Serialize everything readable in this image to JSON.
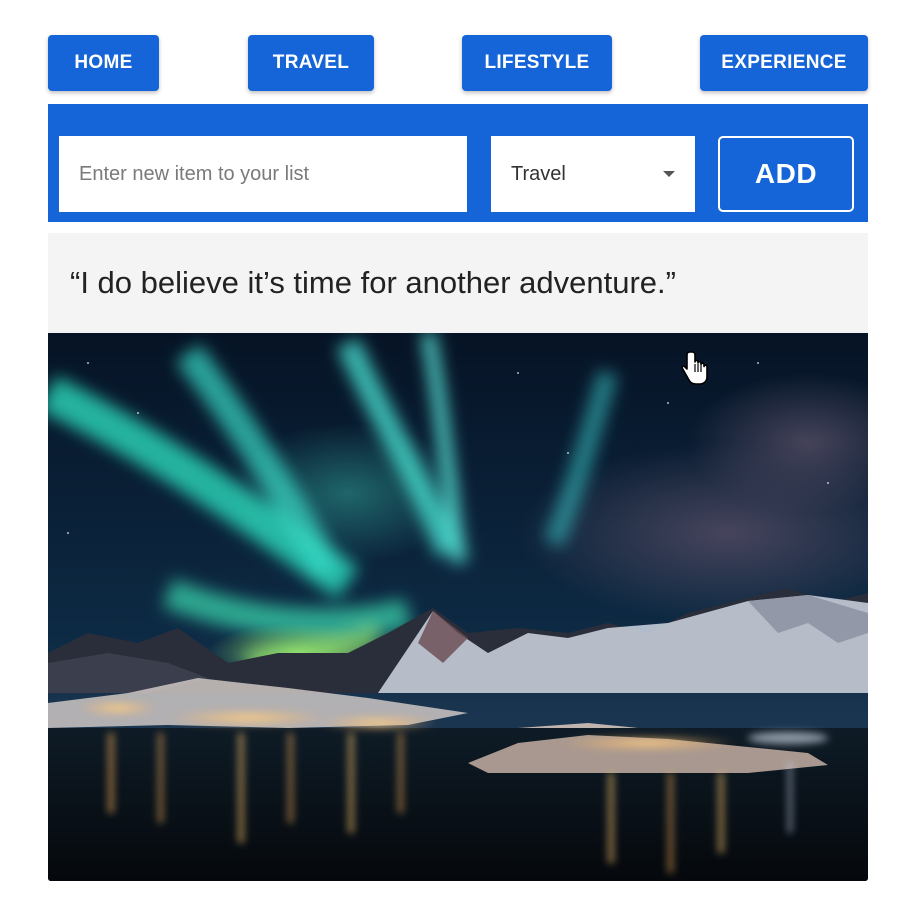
{
  "nav": {
    "items": [
      {
        "label": "HOME"
      },
      {
        "label": "TRAVEL"
      },
      {
        "label": "LIFESTYLE"
      },
      {
        "label": "EXPERIENCE"
      }
    ]
  },
  "form": {
    "input_placeholder": "Enter new item to your list",
    "input_value": "",
    "category_selected": "Travel",
    "add_label": "ADD"
  },
  "quote": {
    "text": "“I do believe it’s time for another adventure.”"
  },
  "image": {
    "subject": "aurora-over-mountain-lake-landscape"
  },
  "icons": {
    "dropdown": "chevron-down-icon",
    "cursor": "hand-pointer-icon"
  },
  "colors": {
    "primary": "#1565d8",
    "quote_bg": "#f4f4f4",
    "text": "#222222"
  }
}
